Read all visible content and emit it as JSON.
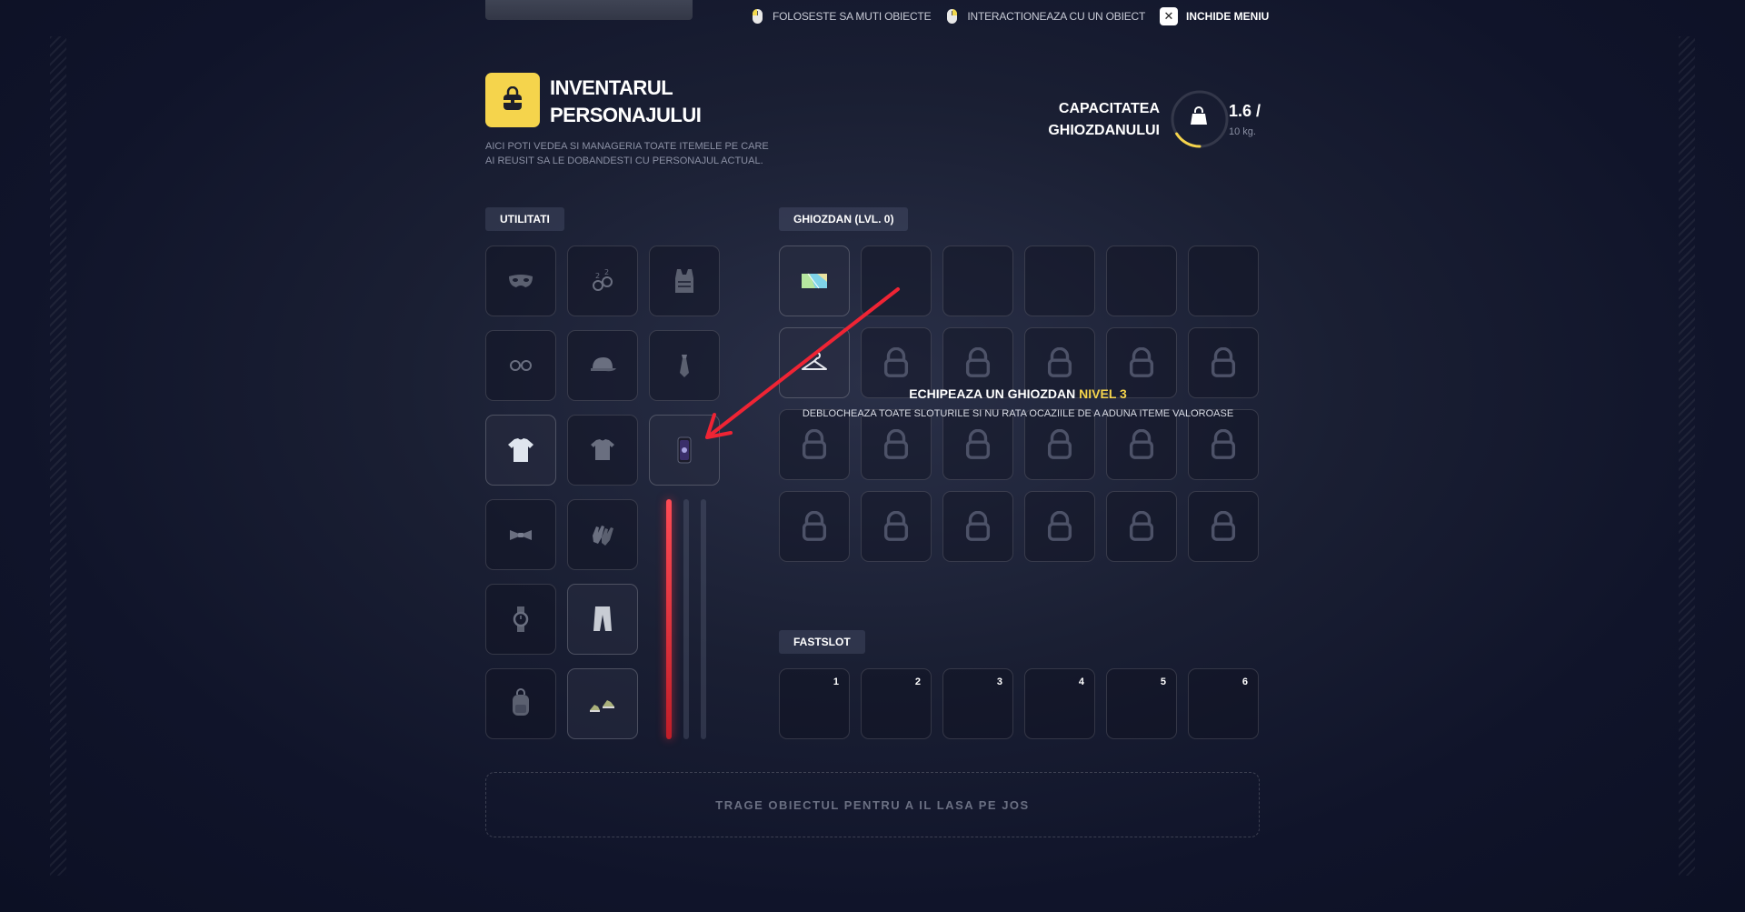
{
  "hints": [
    {
      "label": "FOLOSESTE SA MUTI OBIECTE",
      "icon": "mouse-left-icon"
    },
    {
      "label": "INTERACTIONEAZA CU UN OBIECT",
      "icon": "mouse-right-icon"
    }
  ],
  "close_menu": {
    "label": "INCHIDE MENIU",
    "icon": "close-icon"
  },
  "header": {
    "title_line1": "INVENTARUL",
    "title_line2": "PERSONAJULUI",
    "subtitle": "AICI POTI VEDEA SI MANAGERIA TOATE ITEMELE PE CARE AI REUSIT SA LE DOBANDESTI CU PERSONAJUL ACTUAL."
  },
  "capacity": {
    "label_line1": "CAPACITATEA",
    "label_line2": "GHIOZDANULUI",
    "value": "1.6 /",
    "max": "10 kg.",
    "fill_fraction": 0.16
  },
  "utilities": {
    "tag": "UTILITATI",
    "slots": [
      {
        "icon": "mask-icon"
      },
      {
        "icon": "earrings-icon"
      },
      {
        "icon": "vest-icon"
      },
      {
        "icon": "glasses-icon"
      },
      {
        "icon": "cap-icon"
      },
      {
        "icon": "tie-icon"
      },
      {
        "icon": "tshirt-white-icon"
      },
      {
        "icon": "tshirt-icon"
      },
      {
        "icon": "phone-icon"
      },
      {
        "icon": "bowtie-icon"
      },
      {
        "icon": "gloves-icon"
      },
      {
        "icon": "watch-icon"
      },
      {
        "icon": "pants-icon"
      },
      {
        "icon": "backpack-icon"
      },
      {
        "icon": "shoes-icon"
      }
    ]
  },
  "backpack": {
    "tag": "GHIOZDAN (LVL. 0)",
    "locked_message": "ECHIPEAZA UN GHIOZDAN",
    "locked_level": "NIVEL 3",
    "locked_sub": "DEBLOCHEAZA TOATE SLOTURILE SI NU RATA OCAZIILE DE A ADUNA ITEME VALOROASE"
  },
  "fastslot": {
    "tag": "FASTSLOT",
    "slots": [
      "1",
      "2",
      "3",
      "4",
      "5",
      "6"
    ]
  },
  "drop_zone": "TRAGE OBIECTUL PENTRU A IL LASA PE JOS",
  "colors": {
    "accent": "#f5d44c",
    "danger": "#e8303a"
  }
}
